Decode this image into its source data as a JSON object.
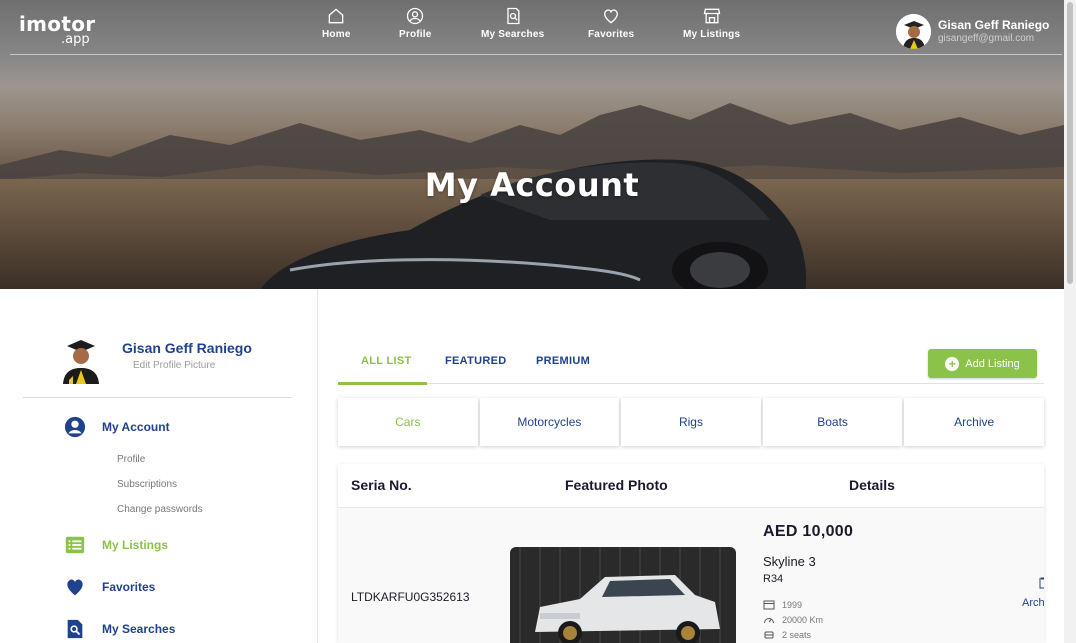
{
  "brand": {
    "logo_line1": "imotor",
    "logo_line2": ".app"
  },
  "nav": {
    "items": [
      {
        "label": "Home",
        "icon": "home-icon"
      },
      {
        "label": "Profile",
        "icon": "user-circle-icon"
      },
      {
        "label": "My Searches",
        "icon": "search-document-icon"
      },
      {
        "label": "Favorites",
        "icon": "heart-icon"
      },
      {
        "label": "My Listings",
        "icon": "store-icon"
      }
    ]
  },
  "user": {
    "name": "Gisan Geff Raniego",
    "email": "gisangeff@gmail.com"
  },
  "hero": {
    "title": "My Account"
  },
  "sidebar": {
    "profile_name": "Gisan Geff Raniego",
    "edit_picture": "Edit Profile Picture",
    "my_account": "My Account",
    "sub_items": [
      "Profile",
      "Subscriptions",
      "Change passwords"
    ],
    "my_listings": "My Listings",
    "favorites": "Favorites",
    "my_searches": "My Searches"
  },
  "tabs": [
    "ALL LIST",
    "FEATURED",
    "PREMIUM"
  ],
  "add_listing": "Add Listing",
  "categories": [
    "Cars",
    "Motorcycles",
    "Rigs",
    "Boats",
    "Archive"
  ],
  "table": {
    "headers": [
      "Seria No.",
      "Featured Photo",
      "Details"
    ],
    "rows": [
      {
        "serial": "LTDKARFU0G352613",
        "price": "AED 10,000",
        "model": "Skyline 3",
        "variant": "R34",
        "year": "1999",
        "mileage": "20000 Km",
        "seats": "2 seats",
        "action": "Archive"
      }
    ]
  },
  "colors": {
    "accent": "#8bc34a",
    "primary": "#20428c",
    "text": "#1a1a2e"
  }
}
